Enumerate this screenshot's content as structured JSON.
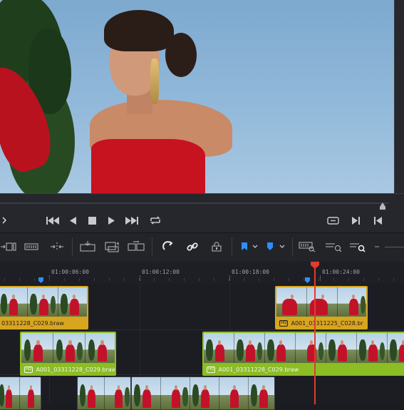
{
  "viewer": {
    "description_alt": ""
  },
  "transport": {
    "buttons": [
      "jump-to-start",
      "step-back",
      "stop",
      "play",
      "jump-to-end",
      "loop"
    ],
    "right_buttons": [
      "match-frame",
      "next-edit",
      "previous-edit"
    ]
  },
  "ruler": {
    "timecodes": [
      "01:00:06:00",
      "01:00:12:00",
      "01:00:18:00",
      "01:00:24:00"
    ]
  },
  "timeline": {
    "track_v3": [
      {
        "name": "03311228_C029.braw",
        "color": "#d8a51f"
      },
      {
        "name": "A001_03311225_C028.br",
        "color": "#d8a51f",
        "badge": "HQ"
      }
    ],
    "track_v2": [
      {
        "name": "A001_03311228_C029.braw",
        "color": "#8bbd24",
        "badge": "HQ"
      },
      {
        "name": "A001_03311228_C029.braw",
        "color": "#8bbd24",
        "badge": "HQ"
      }
    ]
  },
  "colors": {
    "playhead": "#e23b2f",
    "marker": "#2f8dff",
    "clip_orange": "#d8a51f",
    "clip_green": "#8bbd24"
  }
}
